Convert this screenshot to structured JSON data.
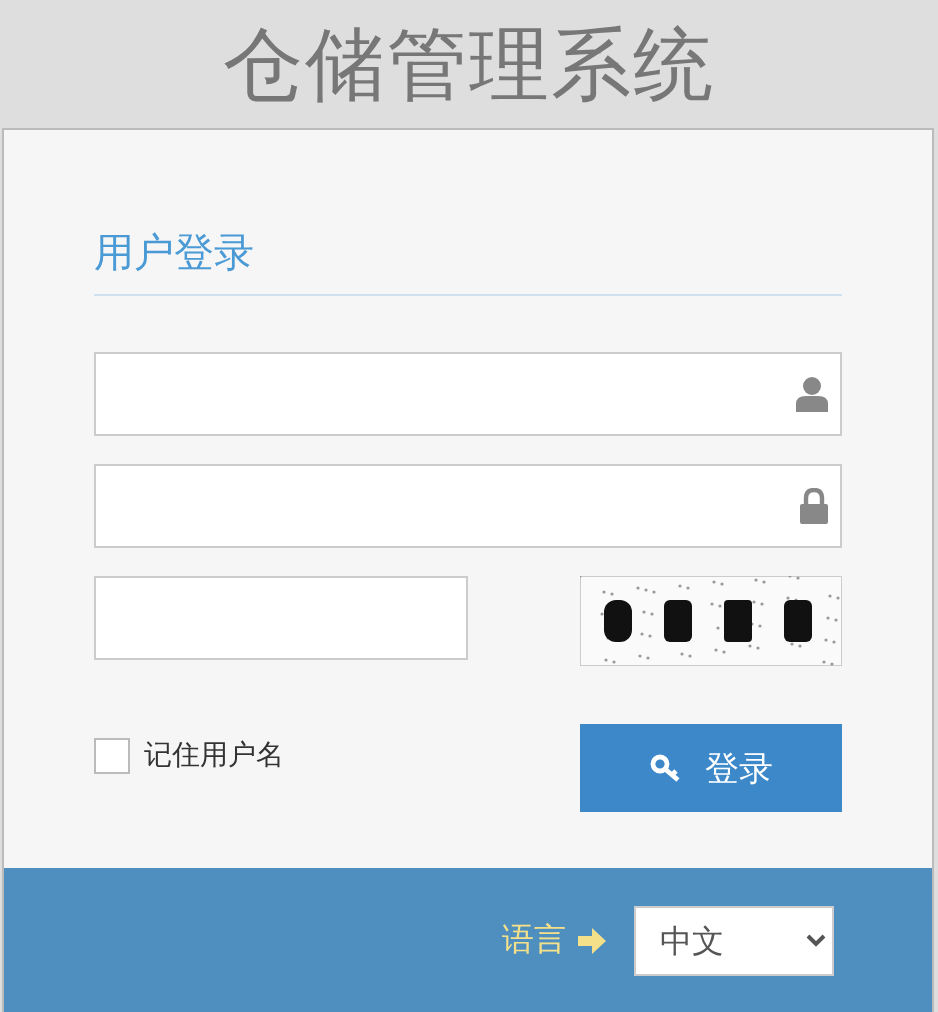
{
  "header": {
    "title": "仓储管理系统"
  },
  "login": {
    "heading": "用户登录",
    "fields": [
      {
        "kind": "username"
      },
      {
        "kind": "password"
      }
    ],
    "remember": {
      "label": "记住用户名",
      "checked": false
    },
    "submit": {
      "label": "登录"
    }
  },
  "footer": {
    "language_label": "语言",
    "language": "中文"
  }
}
